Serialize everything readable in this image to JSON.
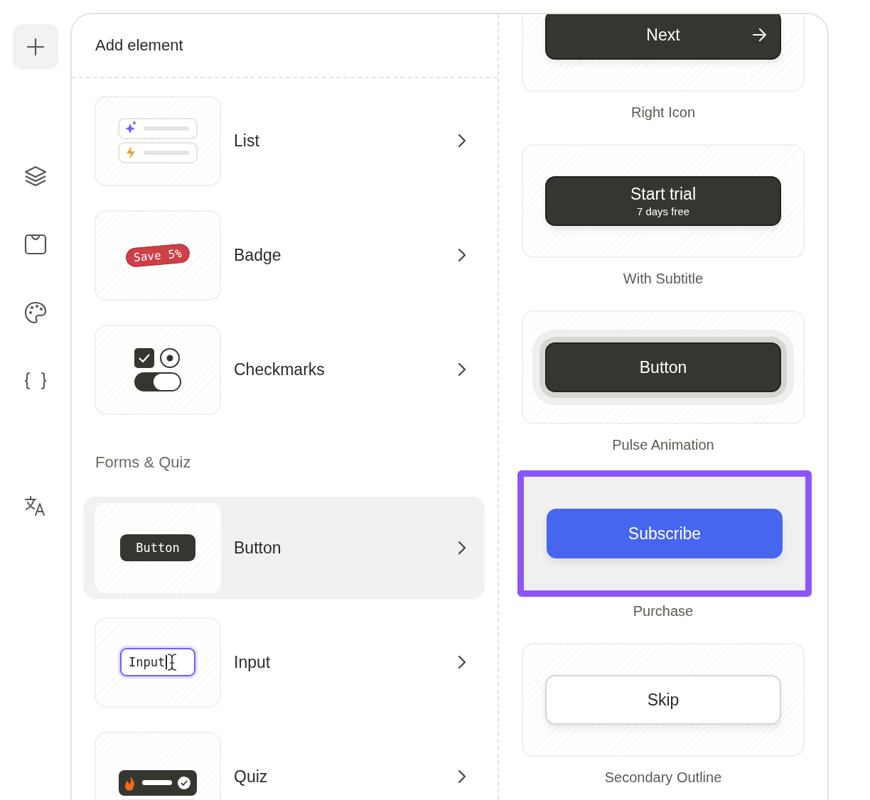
{
  "sidebar": {
    "groups": [
      {
        "items": [
          {
            "kind": "plus",
            "selected": true
          }
        ]
      },
      {
        "items": [
          {
            "kind": "layers",
            "selected": false
          },
          {
            "kind": "bag",
            "selected": false
          },
          {
            "kind": "palette",
            "selected": false
          },
          {
            "kind": "braces",
            "selected": false
          }
        ]
      },
      {
        "items": [
          {
            "kind": "translate",
            "selected": false
          }
        ]
      }
    ]
  },
  "panel": {
    "title": "Add element",
    "groups": [
      {
        "items": [
          {
            "label": "List",
            "kind": "list",
            "selected": false
          },
          {
            "label": "Badge",
            "kind": "badge",
            "badge_text": "Save",
            "badge_value": "5%",
            "selected": false
          },
          {
            "label": "Checkmarks",
            "kind": "checkmarks",
            "selected": false
          }
        ]
      },
      {
        "title": "Forms & Quiz",
        "items": [
          {
            "label": "Button",
            "kind": "button",
            "sample": "Button",
            "selected": true
          },
          {
            "label": "Input",
            "kind": "input",
            "sample": "Input",
            "selected": false
          },
          {
            "label": "Quiz",
            "kind": "quiz",
            "selected": false
          }
        ]
      }
    ]
  },
  "variants": [
    {
      "kind": "icon-right",
      "button": "Next",
      "label": "Right Icon",
      "selected": false
    },
    {
      "kind": "subtitle",
      "button": "Start trial",
      "subtitle": "7 days free",
      "label": "With Subtitle",
      "selected": false
    },
    {
      "kind": "pulse",
      "button": "Button",
      "label": "Pulse Animation",
      "selected": false
    },
    {
      "kind": "primary",
      "button": "Subscribe",
      "label": "Purchase",
      "selected": true
    },
    {
      "kind": "outline",
      "button": "Skip",
      "label": "Secondary Outline",
      "selected": false
    }
  ]
}
